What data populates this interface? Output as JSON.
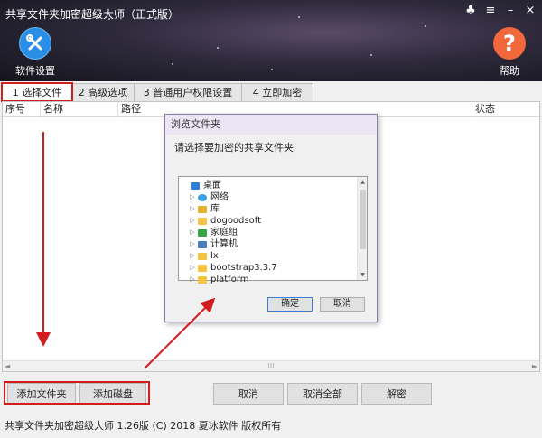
{
  "window": {
    "title": "共享文件夹加密超级大师（正式版）"
  },
  "window_controls": [
    {
      "name": "skin",
      "glyph": "♣"
    },
    {
      "name": "menu",
      "glyph": "≡"
    },
    {
      "name": "minimize",
      "glyph": "–"
    },
    {
      "name": "close",
      "glyph": "×"
    }
  ],
  "toolbar": {
    "settings_label": "软件设置",
    "help_label": "帮助",
    "help_glyph": "?"
  },
  "tabs": [
    {
      "label": "1 选择文件夹",
      "active": true
    },
    {
      "label": "2 高级选项",
      "active": false
    },
    {
      "label": "3 普通用户权限设置",
      "active": false
    },
    {
      "label": "4 立即加密",
      "active": false
    }
  ],
  "table": {
    "columns": [
      "序号",
      "名称",
      "路径",
      "状态"
    ]
  },
  "scrollbar": {
    "left": "◄",
    "grip": "III",
    "right": "►"
  },
  "dialog": {
    "title": "浏览文件夹",
    "prompt": "请选择要加密的共享文件夹",
    "tree": [
      {
        "label": "桌面",
        "icon": "desktop",
        "indent": 0,
        "has_arrow": false
      },
      {
        "label": "网络",
        "icon": "net",
        "indent": 1,
        "has_arrow": true
      },
      {
        "label": "库",
        "icon": "lib",
        "indent": 1,
        "has_arrow": true
      },
      {
        "label": "dogoodsoft",
        "icon": "folder",
        "indent": 1,
        "has_arrow": true
      },
      {
        "label": "家庭组",
        "icon": "home",
        "indent": 1,
        "has_arrow": true
      },
      {
        "label": "计算机",
        "icon": "pc",
        "indent": 1,
        "has_arrow": true
      },
      {
        "label": "lx",
        "icon": "folder",
        "indent": 1,
        "has_arrow": true
      },
      {
        "label": "bootstrap3.3.7",
        "icon": "folder",
        "indent": 1,
        "has_arrow": true
      },
      {
        "label": "platform",
        "icon": "folder",
        "indent": 1,
        "has_arrow": true
      }
    ],
    "ok_label": "确定",
    "cancel_label": "取消"
  },
  "buttons": {
    "add_folder": "添加文件夹",
    "add_disk": "添加磁盘",
    "cancel": "取消",
    "cancel_all": "取消全部",
    "decrypt": "解密"
  },
  "status": {
    "text": "共享文件夹加密超级大师 1.26版 (C) 2018 夏冰软件 版权所有"
  },
  "colors": {
    "highlight": "#d31c1c",
    "settings_icon": "#2a8ee6",
    "help_icon": "#f0683c"
  }
}
